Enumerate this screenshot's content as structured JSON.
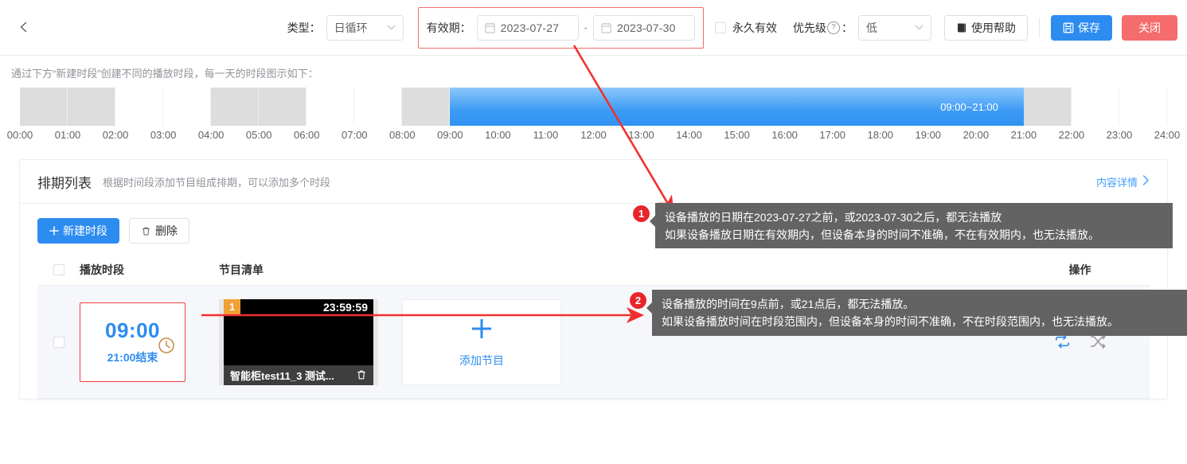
{
  "header": {
    "back_icon": "chevron-left-icon",
    "type_label": "类型：",
    "type_value": "日循环",
    "validity_label": "有效期：",
    "date_start": "2023-07-27",
    "date_end": "2023-07-30",
    "date_separator": "-",
    "calendar_icon": "calendar-icon",
    "permanent_label": "永久有效",
    "permanent_checked": false,
    "priority_label": "优先级",
    "priority_help_icon": "question-circle-icon",
    "priority_colon": "：",
    "priority_value": "低",
    "help_label": "使用帮助",
    "help_icon": "book-icon",
    "save_label": "保存",
    "save_icon": "save-icon",
    "close_label": "关闭",
    "accent_blue": "#2d8cf0",
    "danger_red": "#f56c6c",
    "highlight_red": "#f03f3f"
  },
  "timeline": {
    "hint": "通过下方“新建时段”创建不同的播放时段，每一天的时段图示如下：",
    "ticks": [
      "00:00",
      "01:00",
      "02:00",
      "03:00",
      "04:00",
      "05:00",
      "06:00",
      "07:00",
      "08:00",
      "09:00",
      "10:00",
      "11:00",
      "12:00",
      "13:00",
      "14:00",
      "15:00",
      "16:00",
      "17:00",
      "18:00",
      "19:00",
      "20:00",
      "21:00",
      "22:00",
      "23:00",
      "24:00"
    ],
    "range_label": "09:00~21:00",
    "range_start_hour": 9,
    "range_end_hour": 21,
    "band_pattern": "2 gray / 2 white per 4 hours"
  },
  "schedule_card": {
    "title": "排期列表",
    "subtitle": "根据时间段添加节目组成排期，可以添加多个时段",
    "detail_link": "内容详情",
    "detail_chevron": "chevron-right-icon",
    "new_slot_label": "新建时段",
    "new_slot_icon": "plus-icon",
    "delete_label": "删除",
    "delete_icon": "trash-icon",
    "columns": {
      "checkbox": "",
      "time_slot": "播放时段",
      "program_list": "节目清单",
      "operation": "操作"
    },
    "row": {
      "selected": false,
      "slot_start": "09:00",
      "slot_end": "21:00结束",
      "clock_icon": "clock-icon",
      "programs": [
        {
          "index": "1",
          "duration": "23:59:59",
          "name": "智能柜test11_3 测试...",
          "delete_icon": "trash-icon"
        }
      ],
      "add_program_label": "添加节目",
      "add_program_icon": "plus-icon",
      "operations": [
        {
          "name": "loop-icon",
          "active": true
        },
        {
          "name": "shuffle-icon",
          "active": false
        }
      ]
    }
  },
  "annotations": [
    {
      "number": "1",
      "text": "设备播放的日期在2023-07-27之前，或2023-07-30之后，都无法播放\n如果设备播放日期在有效期内，但设备本身的时间不准确，不在有效期内，也无法播放。"
    },
    {
      "number": "2",
      "text": "设备播放的时间在9点前，或21点后，都无法播放。\n如果设备播放时间在时段范围内，但设备本身的时间不准确，不在时段范围内，也无法播放。"
    }
  ]
}
